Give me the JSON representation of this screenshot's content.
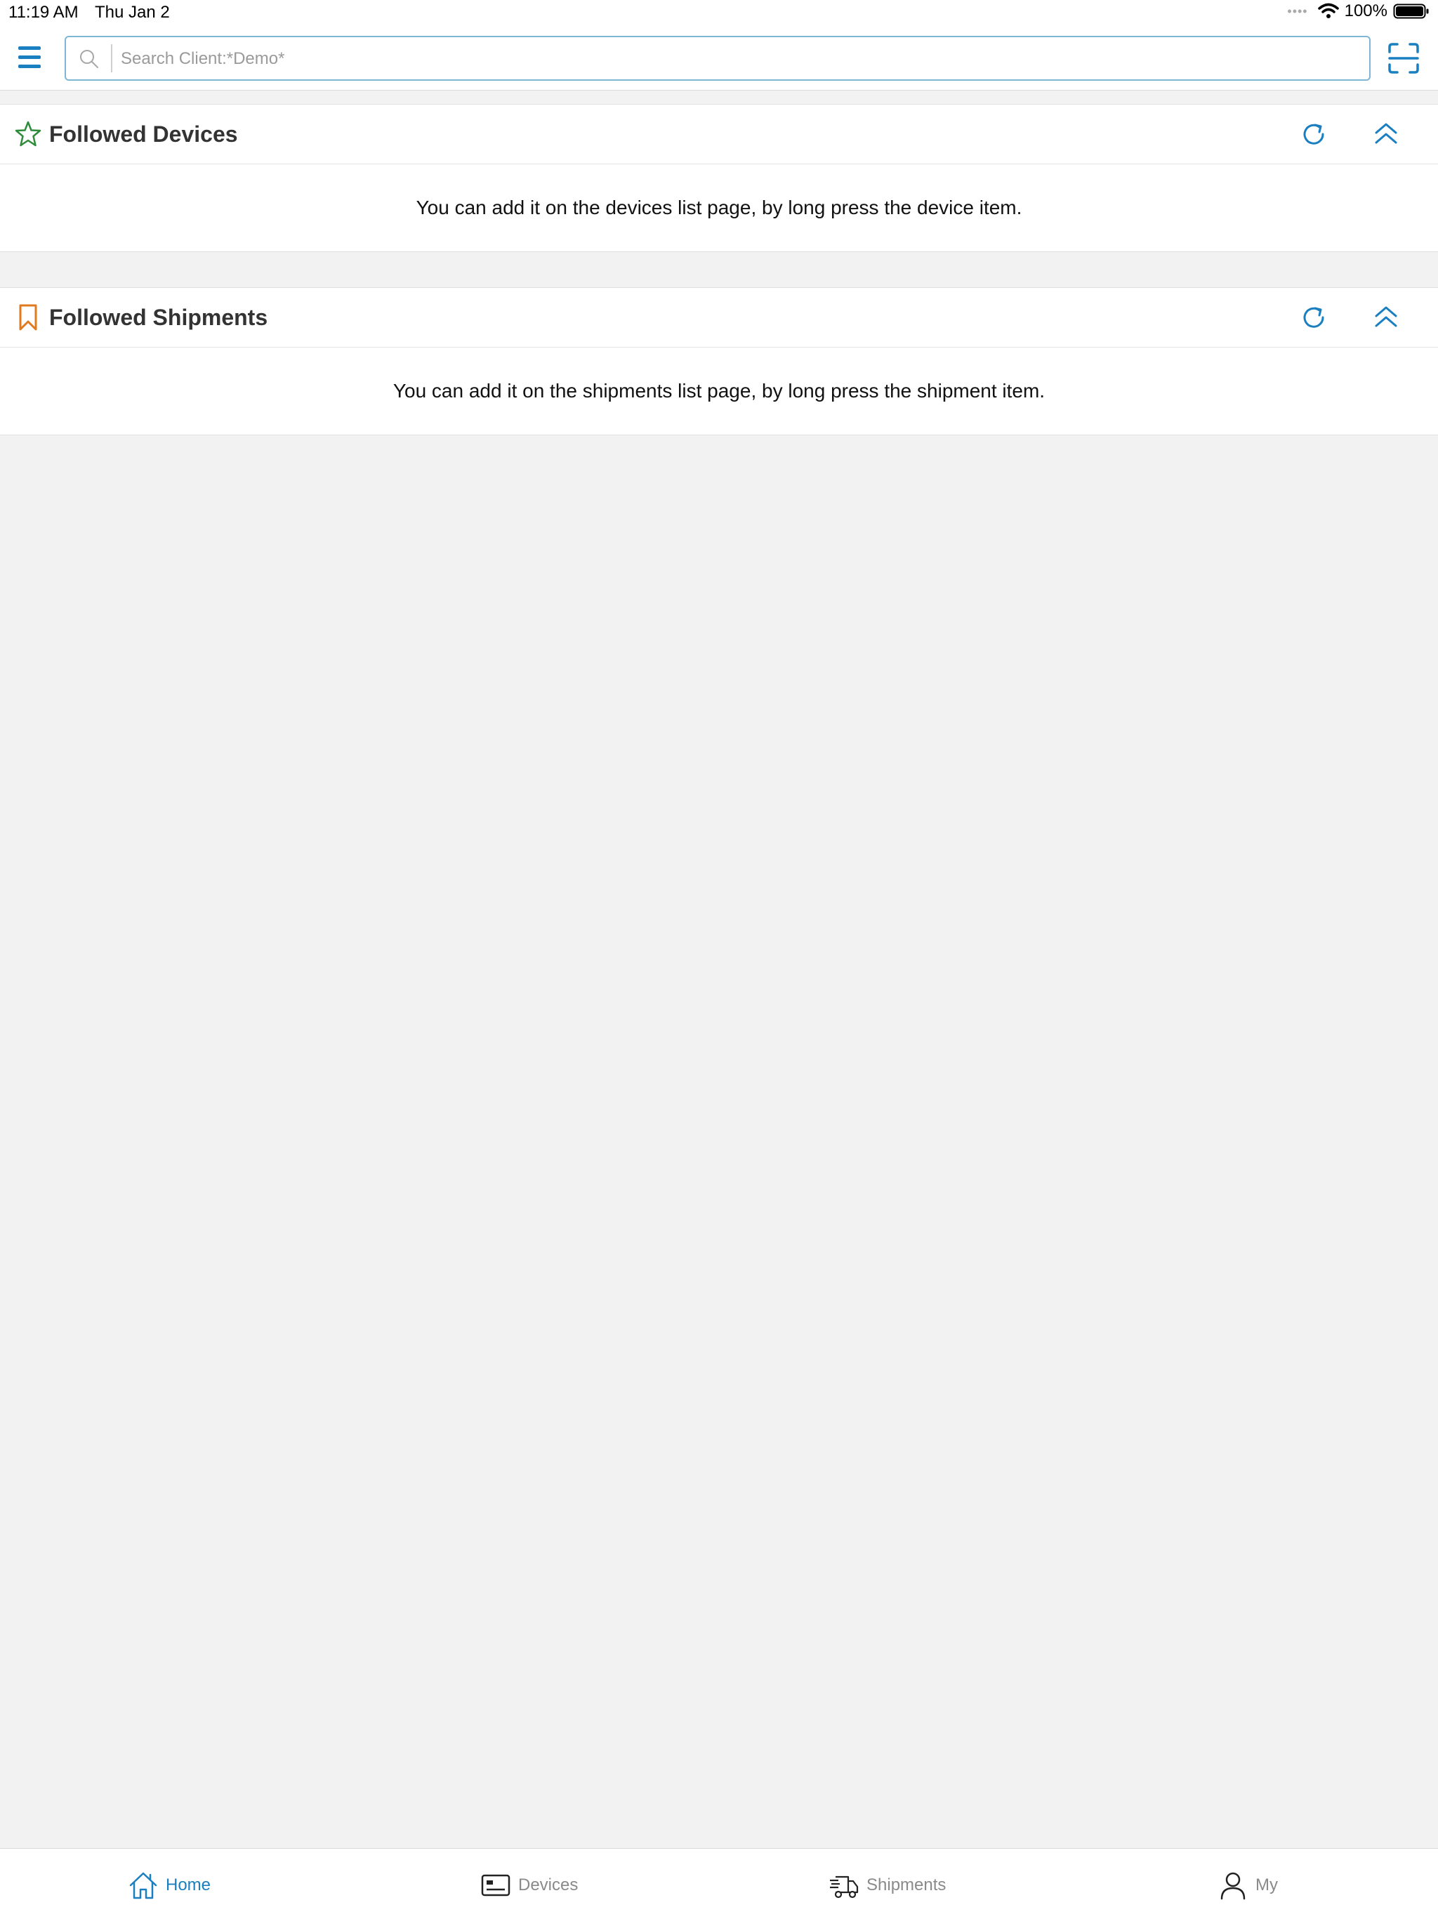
{
  "status": {
    "time": "11:19 AM",
    "date": "Thu Jan 2",
    "battery": "100%"
  },
  "search": {
    "placeholder": "Search Client:*Demo*"
  },
  "sections": [
    {
      "title": "Followed Devices",
      "empty_message": "You can add it on the devices list page, by long press the device item.",
      "icon": "star-icon",
      "icon_color": "#2e8b3a"
    },
    {
      "title": "Followed Shipments",
      "empty_message": "You can add it on the shipments list page, by long press the shipment item.",
      "icon": "bookmark-icon",
      "icon_color": "#e07a1f"
    }
  ],
  "tabs": [
    {
      "label": "Home",
      "icon": "home-icon",
      "active": true
    },
    {
      "label": "Devices",
      "icon": "devices-icon",
      "active": false
    },
    {
      "label": "Shipments",
      "icon": "truck-icon",
      "active": false
    },
    {
      "label": "My",
      "icon": "person-icon",
      "active": false
    }
  ],
  "colors": {
    "accent": "#1a7fc0",
    "background": "#f2f2f2",
    "inactive_tab": "#8a8a8a"
  }
}
